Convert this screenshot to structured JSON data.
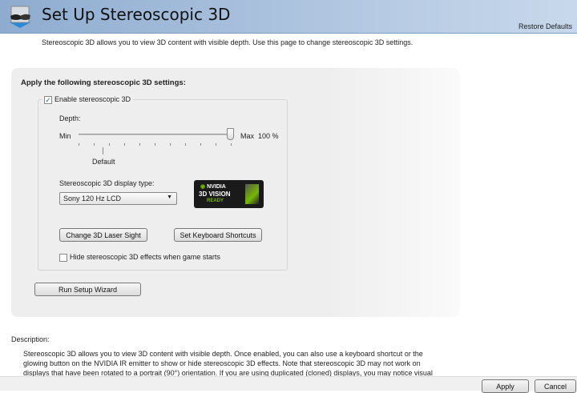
{
  "header": {
    "title": "Set Up Stereoscopic 3D",
    "restore_defaults": "Restore Defaults"
  },
  "subtitle": "Stereoscopic 3D allows you to view 3D content with visible depth. Use this page to change stereoscopic 3D settings.",
  "settings": {
    "heading": "Apply the following stereoscopic 3D settings:",
    "enable_label": "Enable stereoscopic 3D",
    "enable_checked": true,
    "depth_label": "Depth:",
    "min_label": "Min",
    "max_label": "Max",
    "depth_value": "100 %",
    "depth_fraction": 1.0,
    "default_label": "Default",
    "display_type_label": "Stereoscopic 3D display type:",
    "display_type_value": "Sony 120 Hz LCD",
    "logo": {
      "brand": "NVIDIA",
      "line1": "3D VISION",
      "line2": "READY"
    },
    "laser_sight_button": "Change 3D Laser Sight",
    "keyboard_shortcuts_button": "Set Keyboard Shortcuts",
    "hide_effects_label": "Hide stereoscopic 3D effects when game starts",
    "hide_effects_checked": false,
    "wizard_button": "Run Setup Wizard"
  },
  "description": {
    "label": "Description:",
    "lines": [
      "Stereoscopic 3D allows you to view 3D content with visible depth. Once enabled, you can also use a keyboard shortcut or the",
      "glowing button on the NVIDIA IR emitter to show or hide stereoscopic 3D effects. Note that stereoscopic 3D may not work on",
      "displays that have been rotated to a portrait (90°) orientation. If you are using duplicated (cloned) displays, you may notice visual"
    ]
  },
  "footer": {
    "apply": "Apply",
    "cancel": "Cancel"
  }
}
